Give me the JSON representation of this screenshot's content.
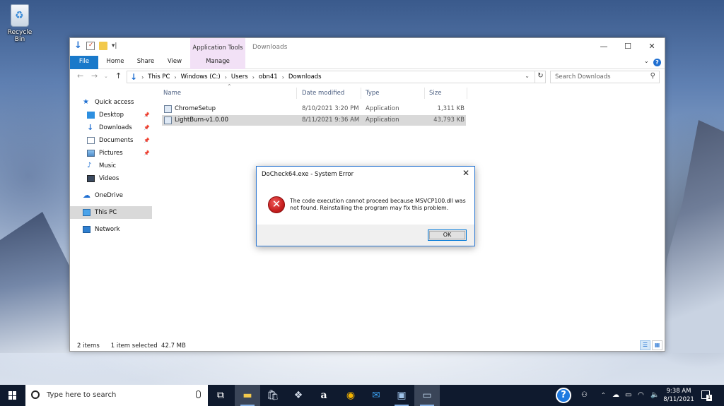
{
  "desktop": {
    "recycle_bin_label": "Recycle Bin"
  },
  "explorer": {
    "title": "Downloads",
    "contextual_tab_header": "Application Tools",
    "ribbon_tabs": [
      "File",
      "Home",
      "Share",
      "View",
      "Manage"
    ],
    "breadcrumb": [
      "This PC",
      "Windows (C:)",
      "Users",
      "obn41",
      "Downloads"
    ],
    "search_placeholder": "Search Downloads",
    "nav_items": [
      {
        "label": "Quick access",
        "icon": "star-icon"
      },
      {
        "label": "Desktop",
        "icon": "desktop-folder-icon",
        "pinned": true
      },
      {
        "label": "Downloads",
        "icon": "downloads-folder-icon",
        "pinned": true
      },
      {
        "label": "Documents",
        "icon": "documents-folder-icon",
        "pinned": true
      },
      {
        "label": "Pictures",
        "icon": "pictures-folder-icon",
        "pinned": true
      },
      {
        "label": "Music",
        "icon": "music-folder-icon"
      },
      {
        "label": "Videos",
        "icon": "videos-folder-icon"
      },
      {
        "label": "OneDrive",
        "icon": "onedrive-cloud-icon"
      },
      {
        "label": "This PC",
        "icon": "computer-icon",
        "selected": true
      },
      {
        "label": "Network",
        "icon": "network-icon"
      }
    ],
    "columns": [
      "Name",
      "Date modified",
      "Type",
      "Size"
    ],
    "files": [
      {
        "name": "ChromeSetup",
        "date": "8/10/2021 3:20 PM",
        "type": "Application",
        "size": "1,311 KB"
      },
      {
        "name": "LightBurn-v1.0.00",
        "date": "8/11/2021 9:36 AM",
        "type": "Application",
        "size": "43,793 KB",
        "selected": true
      }
    ],
    "status": {
      "item_count": "2 items",
      "selection": "1 item selected  42.7 MB"
    }
  },
  "dialog": {
    "title": "DoCheck64.exe - System Error",
    "message": "The code execution cannot proceed because MSVCP100.dll was not found. Reinstalling the program may fix this problem.",
    "ok_label": "OK"
  },
  "taskbar": {
    "search_placeholder": "Type here to search",
    "time": "9:38 AM",
    "date": "8/11/2021",
    "notification_count": "1",
    "accent": "#0f1a2e"
  }
}
